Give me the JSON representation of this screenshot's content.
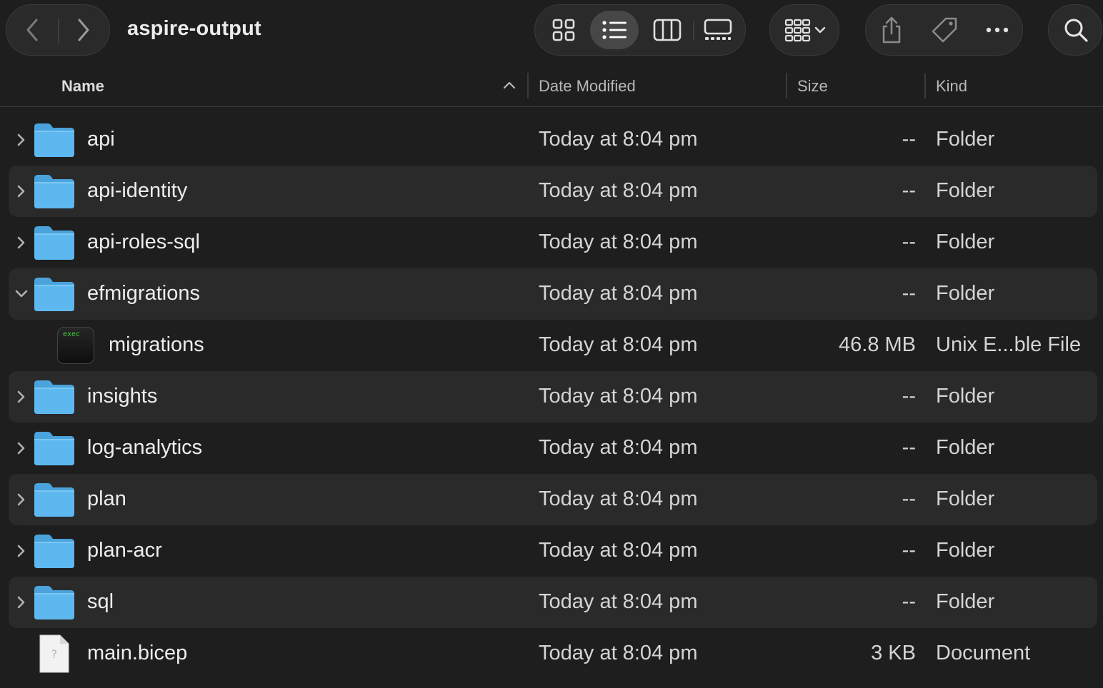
{
  "window": {
    "title": "aspire-output"
  },
  "toolbar": {
    "back_icon": "chevron-left-icon",
    "forward_icon": "chevron-right-icon",
    "views": [
      {
        "name": "icon-view",
        "active": false
      },
      {
        "name": "list-view",
        "active": true
      },
      {
        "name": "column-view",
        "active": false
      },
      {
        "name": "gallery-view",
        "active": false
      }
    ]
  },
  "columns": {
    "name": "Name",
    "date": "Date Modified",
    "size": "Size",
    "kind": "Kind"
  },
  "rows": [
    {
      "name": "api",
      "date": "Today at 8:04 pm",
      "size": "--",
      "kind": "Folder",
      "type": "folder",
      "expanded": false
    },
    {
      "name": "api-identity",
      "date": "Today at 8:04 pm",
      "size": "--",
      "kind": "Folder",
      "type": "folder",
      "expanded": false
    },
    {
      "name": "api-roles-sql",
      "date": "Today at 8:04 pm",
      "size": "--",
      "kind": "Folder",
      "type": "folder",
      "expanded": false
    },
    {
      "name": "efmigrations",
      "date": "Today at 8:04 pm",
      "size": "--",
      "kind": "Folder",
      "type": "folder",
      "expanded": true
    },
    {
      "name": "migrations",
      "date": "Today at 8:04 pm",
      "size": "46.8 MB",
      "kind": "Unix E...ble File",
      "type": "exec",
      "icon_label": "exec"
    },
    {
      "name": "insights",
      "date": "Today at 8:04 pm",
      "size": "--",
      "kind": "Folder",
      "type": "folder",
      "expanded": false
    },
    {
      "name": "log-analytics",
      "date": "Today at 8:04 pm",
      "size": "--",
      "kind": "Folder",
      "type": "folder",
      "expanded": false
    },
    {
      "name": "plan",
      "date": "Today at 8:04 pm",
      "size": "--",
      "kind": "Folder",
      "type": "folder",
      "expanded": false
    },
    {
      "name": "plan-acr",
      "date": "Today at 8:04 pm",
      "size": "--",
      "kind": "Folder",
      "type": "folder",
      "expanded": false
    },
    {
      "name": "sql",
      "date": "Today at 8:04 pm",
      "size": "--",
      "kind": "Folder",
      "type": "folder",
      "expanded": false
    },
    {
      "name": "main.bicep",
      "date": "Today at 8:04 pm",
      "size": "3 KB",
      "kind": "Document",
      "type": "document"
    }
  ],
  "colors": {
    "folder": "#5db8ef",
    "folder_tab": "#4aa3dc",
    "background": "#1e1e1e",
    "row_alt": "#2a2a2a"
  }
}
